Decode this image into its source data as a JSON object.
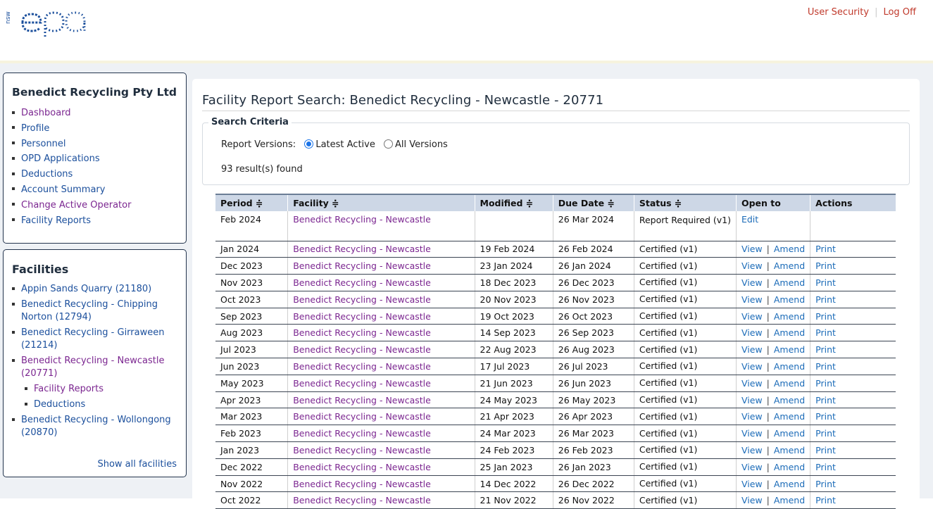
{
  "header": {
    "logo_alt": "nsw epa",
    "links": [
      {
        "label": "User Security"
      },
      {
        "label": "Log Off"
      }
    ]
  },
  "company_panel": {
    "title": "Benedict Recycling Pty Ltd",
    "items": [
      {
        "label": "Dashboard"
      },
      {
        "label": "Profile"
      },
      {
        "label": "Personnel"
      },
      {
        "label": "OPD Applications"
      },
      {
        "label": "Deductions"
      },
      {
        "label": "Account Summary"
      },
      {
        "label": "Change Active Operator"
      },
      {
        "label": "Facility Reports"
      }
    ]
  },
  "facilities_panel": {
    "title": "Facilities",
    "items": [
      {
        "label": "Appin Sands Quarry (21180)"
      },
      {
        "label": "Benedict Recycling - Chipping Norton (12794)"
      },
      {
        "label": "Benedict Recycling - Girraween (21214)"
      },
      {
        "label": "Benedict Recycling - Newcastle (20771)"
      },
      {
        "label": "Facility Reports"
      },
      {
        "label": "Deductions"
      },
      {
        "label": "Benedict Recycling - Wollongong (20870)"
      }
    ],
    "show_all": "Show all facilities"
  },
  "main": {
    "title": "Facility Report Search: Benedict Recycling - Newcastle - 20771",
    "criteria_legend": "Search Criteria",
    "versions_label": "Report Versions:",
    "option_latest": "Latest Active",
    "option_all": "All Versions",
    "results_text": "93 result(s) found"
  },
  "table": {
    "headers": [
      "Period ≑",
      "Facility ≑",
      "Modified ≑",
      "Due Date ≑",
      "Status ≑",
      "Open to",
      "Actions"
    ],
    "link_view": "View",
    "link_amend": "Amend",
    "link_print": "Print",
    "link_edit": "Edit",
    "bar": "|",
    "rows": [
      {
        "period": "Feb 2024",
        "facility": "Benedict Recycling - Newcastle",
        "modified": "",
        "due": "26 Mar 2024",
        "status": "Report Required (v1)"
      },
      {
        "period": "Jan 2024",
        "facility": "Benedict Recycling - Newcastle",
        "modified": "19 Feb 2024",
        "due": "26 Feb 2024",
        "status": "Certified (v1)"
      },
      {
        "period": "Dec 2023",
        "facility": "Benedict Recycling - Newcastle",
        "modified": "23 Jan 2024",
        "due": "26 Jan 2024",
        "status": "Certified (v1)"
      },
      {
        "period": "Nov 2023",
        "facility": "Benedict Recycling - Newcastle",
        "modified": "18 Dec 2023",
        "due": "26 Dec 2023",
        "status": "Certified (v1)"
      },
      {
        "period": "Oct 2023",
        "facility": "Benedict Recycling - Newcastle",
        "modified": "20 Nov 2023",
        "due": "26 Nov 2023",
        "status": "Certified (v1)"
      },
      {
        "period": "Sep 2023",
        "facility": "Benedict Recycling - Newcastle",
        "modified": "19 Oct 2023",
        "due": "26 Oct 2023",
        "status": "Certified (v1)"
      },
      {
        "period": "Aug 2023",
        "facility": "Benedict Recycling - Newcastle",
        "modified": "14 Sep 2023",
        "due": "26 Sep 2023",
        "status": "Certified (v1)"
      },
      {
        "period": "Jul 2023",
        "facility": "Benedict Recycling - Newcastle",
        "modified": "22 Aug 2023",
        "due": "26 Aug 2023",
        "status": "Certified (v1)"
      },
      {
        "period": "Jun 2023",
        "facility": "Benedict Recycling - Newcastle",
        "modified": "17 Jul 2023",
        "due": "26 Jul 2023",
        "status": "Certified (v1)"
      },
      {
        "period": "May 2023",
        "facility": "Benedict Recycling - Newcastle",
        "modified": "21 Jun 2023",
        "due": "26 Jun 2023",
        "status": "Certified (v1)"
      },
      {
        "period": "Apr 2023",
        "facility": "Benedict Recycling - Newcastle",
        "modified": "24 May 2023",
        "due": "26 May 2023",
        "status": "Certified (v1)"
      },
      {
        "period": "Mar 2023",
        "facility": "Benedict Recycling - Newcastle",
        "modified": "21 Apr 2023",
        "due": "26 Apr 2023",
        "status": "Certified (v1)"
      },
      {
        "period": "Feb 2023",
        "facility": "Benedict Recycling - Newcastle",
        "modified": "24 Mar 2023",
        "due": "26 Mar 2023",
        "status": "Certified (v1)"
      },
      {
        "period": "Jan 2023",
        "facility": "Benedict Recycling - Newcastle",
        "modified": "24 Feb 2023",
        "due": "26 Feb 2023",
        "status": "Certified (v1)"
      },
      {
        "period": "Dec 2022",
        "facility": "Benedict Recycling - Newcastle",
        "modified": "25 Jan 2023",
        "due": "26 Jan 2023",
        "status": "Certified (v1)"
      },
      {
        "period": "Nov 2022",
        "facility": "Benedict Recycling - Newcastle",
        "modified": "14 Dec 2022",
        "due": "26 Dec 2022",
        "status": "Certified (v1)"
      },
      {
        "period": "Oct 2022",
        "facility": "Benedict Recycling - Newcastle",
        "modified": "21 Nov 2022",
        "due": "26 Nov 2022",
        "status": "Certified (v1)"
      }
    ]
  }
}
